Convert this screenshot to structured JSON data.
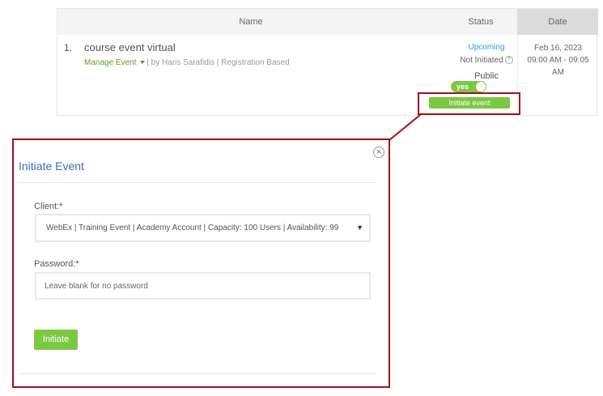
{
  "table": {
    "headers": {
      "name": "Name",
      "status": "Status",
      "date": "Date"
    },
    "rows": [
      {
        "number": "1.",
        "title": "course event virtual",
        "manage_label": "Manage Event",
        "meta_text": "| by Haris Sarafidis | Registration Based",
        "status_upcoming": "Upcoming",
        "status_initiated": "Not Initiated",
        "help_icon_glyph": "?",
        "visibility": "Public",
        "toggle_label": "yes",
        "toggle_on": true,
        "initiate_event_label": "Initiate event",
        "date_line1": "Feb 16, 2023",
        "date_line2": "09:00 AM - 09:05",
        "date_line3": "AM"
      }
    ]
  },
  "modal": {
    "title": "Initiate Event",
    "close_glyph": "×",
    "client_label": "Client:*",
    "client_selected": "WebEx | Training Event | Academy Account | Capacity: 100 Users | Availability: 99",
    "select_arrow": "▼",
    "password_label": "Password:*",
    "password_placeholder": "Leave blank for no password",
    "password_value": "",
    "initiate_button": "Initiate"
  },
  "colors": {
    "accent_green": "#7bc843",
    "link_green": "#5aa02c",
    "upcoming_blue": "#2f9fd6",
    "title_blue": "#3a6fb5",
    "highlight_red": "#a3111a"
  },
  "icons": {
    "close": "close-icon",
    "help": "help-icon",
    "caret": "caret-down-icon",
    "select_arrow": "chevron-down-icon"
  }
}
